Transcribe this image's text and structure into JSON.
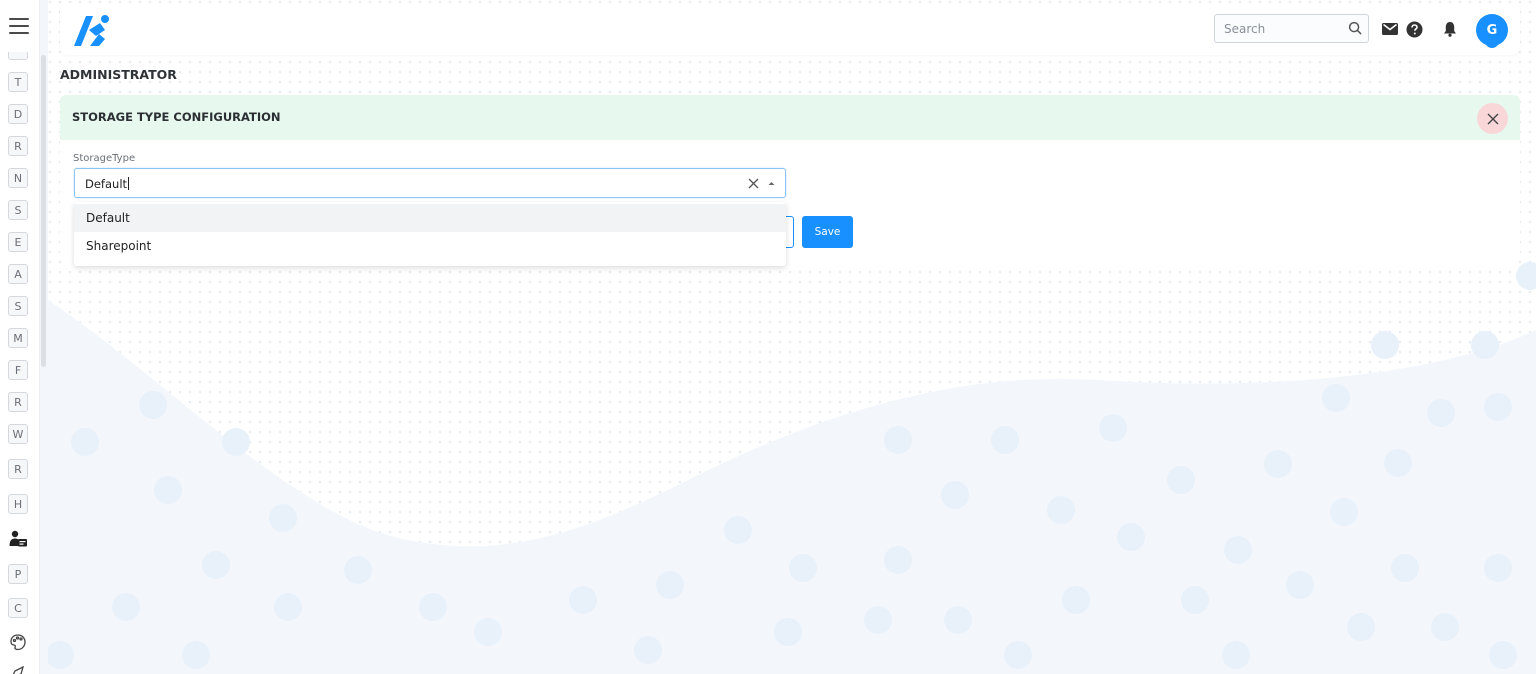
{
  "sidebar": {
    "items": [
      {
        "label": "T"
      },
      {
        "label": "D"
      },
      {
        "label": "R"
      },
      {
        "label": "N"
      },
      {
        "label": "S"
      },
      {
        "label": "E"
      },
      {
        "label": "A"
      },
      {
        "label": "S"
      },
      {
        "label": "M"
      },
      {
        "label": "F"
      },
      {
        "label": "R"
      },
      {
        "label": "W"
      },
      {
        "label": "R"
      },
      {
        "label": "H"
      },
      {
        "icon": "user-card-icon"
      },
      {
        "label": "P"
      },
      {
        "label": "C"
      },
      {
        "icon": "palette-icon"
      },
      {
        "icon": "rocket-icon"
      }
    ]
  },
  "header": {
    "search_placeholder": "Search",
    "avatar_initial": "G",
    "icons": [
      "search-icon",
      "mail-icon",
      "help-icon",
      "bell-icon"
    ]
  },
  "page": {
    "title": "ADMINISTRATOR"
  },
  "card": {
    "title": "STORAGE TYPE CONFIGURATION",
    "field_label": "StorageType",
    "selected_value": "Default",
    "options": [
      "Default",
      "Sharepoint"
    ],
    "save_label": "Save"
  },
  "colors": {
    "primary": "#1890ff",
    "header_bg": "#e7f8ee",
    "close_bg": "#f9d7d9"
  }
}
